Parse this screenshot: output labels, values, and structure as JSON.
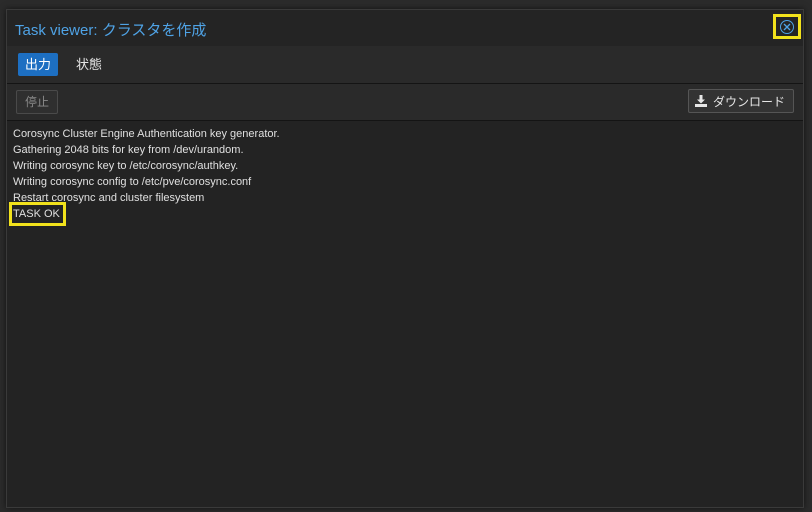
{
  "window": {
    "title": "Task viewer: クラスタを作成"
  },
  "tabs": [
    {
      "label": "出力",
      "active": true
    },
    {
      "label": "状態",
      "active": false
    }
  ],
  "toolbar": {
    "stop_label": "停止",
    "download_label": "ダウンロード"
  },
  "log": {
    "lines": [
      "Corosync Cluster Engine Authentication key generator.",
      "Gathering 2048 bits for key from /dev/urandom.",
      "Writing corosync key to /etc/corosync/authkey.",
      "Writing corosync config to /etc/pve/corosync.conf",
      "Restart corosync and cluster filesystem",
      "TASK OK"
    ]
  },
  "colors": {
    "accent": "#1d6fc2",
    "title": "#4fa3e6",
    "highlight": "#f2e21c"
  },
  "icons": {
    "close": "close-circle-icon",
    "download": "download-icon"
  }
}
